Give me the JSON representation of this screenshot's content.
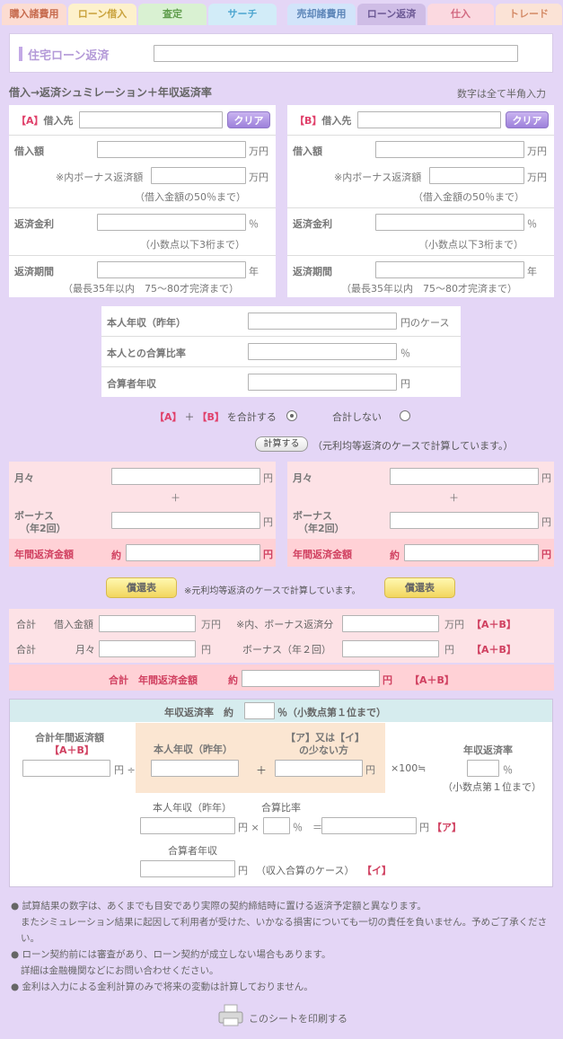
{
  "tabs": [
    {
      "label": "購入諸費用",
      "color": "#fcdcd2"
    },
    {
      "label": "ローン借入",
      "color": "#fdf1cc"
    },
    {
      "label": "査定",
      "color": "#d9f1d2"
    },
    {
      "label": "サーチ",
      "color": "#d2ecf8"
    },
    {
      "label": "売却諸費用",
      "color": "#d2e4fa"
    },
    {
      "label": "ローン返済",
      "color": "#cfbde6"
    },
    {
      "label": "仕入",
      "color": "#fbd9e0"
    },
    {
      "label": "トレード",
      "color": "#fbe3d6"
    }
  ],
  "header": {
    "title": "住宅ローン返済",
    "subtitle": "借入→返済シュミレーション＋年収返済率",
    "hint": "数字は全て半角入力"
  },
  "loan_a": {
    "tag": "【A】",
    "lender_label": "借入先",
    "clear": "クリア",
    "amount_label": "借入額",
    "bonus_label": "※内ボーナス返済額",
    "unit_man": "万円",
    "bonus_note": "（借入金額の50％まで）",
    "rate_label": "返済金利",
    "unit_pct": "％",
    "rate_note": "（小数点以下3桁まで）",
    "period_label": "返済期間",
    "unit_year": "年",
    "period_note": "（最長35年以内　75〜80才完済まで）"
  },
  "loan_b": {
    "tag": "【B】",
    "lender_label": "借入先",
    "clear": "クリア",
    "amount_label": "借入額",
    "bonus_label": "※内ボーナス返済額",
    "unit_man": "万円",
    "bonus_note": "（借入金額の50％まで）",
    "rate_label": "返済金利",
    "unit_pct": "％",
    "rate_note": "（小数点以下3桁まで）",
    "period_label": "返済期間",
    "unit_year": "年",
    "period_note": "（最長35年以内　75〜80才完済まで）"
  },
  "income": {
    "self_label": "本人年収（昨年）",
    "self_unit": "円のケース",
    "ratio_label": "本人との合算比率",
    "ratio_unit": "％",
    "partner_label": "合算者年収",
    "partner_unit": "円"
  },
  "combine": {
    "a": "【A】",
    "plus": "＋",
    "b": "【B】",
    "text": "を合計する",
    "no": "合計しない"
  },
  "calc": {
    "button": "計算する",
    "note": "（元利均等返済のケースで計算しています。）"
  },
  "result_a": {
    "monthly": "月々",
    "plus": "＋",
    "bonus": "ボーナス",
    "bonus_sub": "（年2回）",
    "annual": "年間返済金額",
    "approx": "約",
    "yen": "円"
  },
  "result_b": {
    "monthly": "月々",
    "plus": "＋",
    "bonus": "ボーナス",
    "bonus_sub": "（年2回）",
    "annual": "年間返済金額",
    "approx": "約",
    "yen": "円"
  },
  "schedule": {
    "button_a": "償還表",
    "button_b": "償還表",
    "note": "※元利均等返済のケースで計算しています。"
  },
  "total": {
    "sum": "合計",
    "loan_label": "借入金額",
    "unit_man": "万円",
    "bonus_label": "※内、ボーナス返済分",
    "ab": "【A＋B】",
    "monthly": "月々",
    "yen": "円",
    "bonus_twice": "ボーナス（年２回）",
    "annual_label": "合計　年間返済金額",
    "approx": "約"
  },
  "ratio": {
    "head_label": "年収返済率　約",
    "head_unit": "％（小数点第１位まで）",
    "sum_annual": "合計年間返済額",
    "ab": "【A＋B】",
    "yen_div": "円 ÷",
    "self_income": "本人年収（昨年）",
    "plus": "＋",
    "ai_title": "【ア】又は【イ】",
    "ai_sub": "の少ない方",
    "yen": "円",
    "times100": "×100≒",
    "rate_title": "年収返済率",
    "pct": "％",
    "decimal_note": "（小数点第１位まで）",
    "self_income2": "本人年収（昨年）",
    "merge_ratio": "合算比率",
    "times": "×",
    "eq": "＝",
    "a_tag": "【ア】",
    "partner": "合算者年収",
    "partner_case": "（収入合算のケース）",
    "i_tag": "【イ】"
  },
  "notes": [
    "試算結果の数字は、あくまでも目安であり実際の契約締結時に置ける返済予定額と異なります。",
    "またシミュレーション結果に起因して利用者が受けた、いかなる損害についても一切の責任を負いません。予めご了承ください。",
    "ローン契約前には審査があり、ローン契約が成立しない場合もあります。",
    "詳細は金融機関などにお問い合わせください。",
    "金利は入力による金利計算のみで将来の変動は計算しておりません。"
  ],
  "print_label": "このシートを印刷する"
}
